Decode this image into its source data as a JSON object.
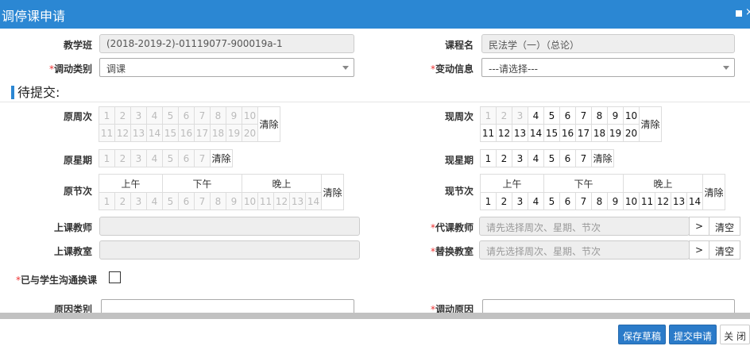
{
  "dialog": {
    "title": "调停课申请"
  },
  "form": {
    "class_label": "教学班",
    "class_value": "(2018-2019-2)-01119077-900019a-1",
    "course_label": "课程名",
    "course_value": "民法学（一）（总论）",
    "change_type_label": "调动类别",
    "change_type_value": "调课",
    "change_info_label": "变动信息",
    "change_info_value": "---请选择---",
    "required_mark": "*"
  },
  "section": {
    "title": "待提交:"
  },
  "schedule": {
    "orig_week_label": "原周次",
    "new_week_label": "现周次",
    "orig_day_label": "原星期",
    "new_day_label": "现星期",
    "orig_period_label": "原节次",
    "new_period_label": "现节次",
    "clear_label": "清除",
    "weeks_row1": [
      "1",
      "2",
      "3",
      "4",
      "5",
      "6",
      "7",
      "8",
      "9",
      "10"
    ],
    "weeks_row2": [
      "11",
      "12",
      "13",
      "14",
      "15",
      "16",
      "17",
      "18",
      "19",
      "20"
    ],
    "days": [
      "1",
      "2",
      "3",
      "4",
      "5",
      "6",
      "7"
    ],
    "period_headers": [
      "上午",
      "下午",
      "晚上"
    ],
    "periods": [
      "1",
      "2",
      "3",
      "4",
      "5",
      "6",
      "7",
      "8",
      "9",
      "10",
      "11",
      "12",
      "13",
      "14"
    ]
  },
  "teacher": {
    "orig_teacher_label": "上课教师",
    "sub_teacher_label": "代课教师",
    "sub_teacher_placeholder": "请先选择周次、星期、节次",
    "orig_room_label": "上课教室",
    "new_room_label": "替换教室",
    "new_room_placeholder": "请先选择周次、星期、节次",
    "pick_label": ">",
    "clear_label": "清空"
  },
  "notice": {
    "communicated_label": "已与学生沟通换课"
  },
  "reason": {
    "type_label": "原因类别",
    "reason_label": "调动原因"
  },
  "footer": {
    "save_draft": "保存草稿",
    "submit": "提交申请",
    "close": "关 闭"
  }
}
